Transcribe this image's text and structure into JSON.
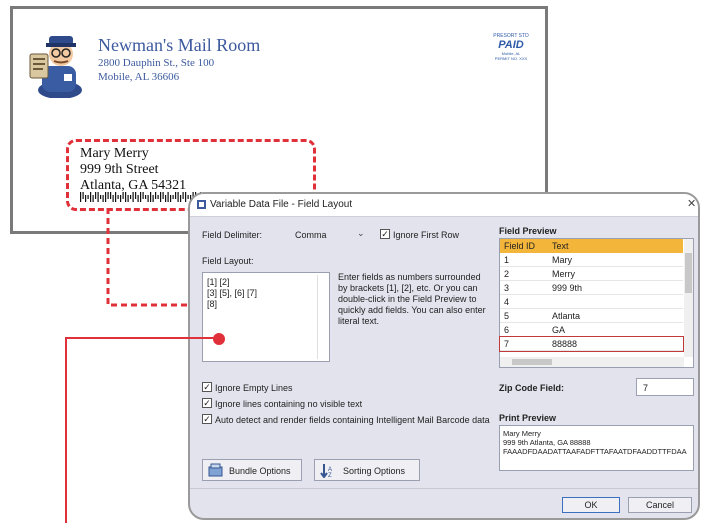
{
  "envelope": {
    "sender": {
      "name": "Newman's Mail Room",
      "line1": "2800 Dauphin St., Ste 100",
      "line2": "Mobile, AL 36606"
    },
    "postage": {
      "line1": "PRESORT STD",
      "paid": "PAID",
      "line2": "Mobile, AL",
      "line3": "PERMIT NO. XXX"
    },
    "recipient": {
      "line1": "Mary Merry",
      "line2": "999 9th Street",
      "line3": "Atlanta, GA 54321"
    }
  },
  "dialog": {
    "title": "Variable Data File - Field Layout",
    "field_delimiter_label": "Field Delimiter:",
    "field_delimiter_value": "Comma",
    "ignore_first_row_label": "Ignore First Row",
    "field_layout_label": "Field Layout:",
    "field_layout_lines": [
      "[1] [2]",
      "[3] [5], [6] [7]",
      "[8]"
    ],
    "help_text": "Enter fields as numbers surrounded by brackets [1], [2], etc.  Or you can double-click in the Field Preview to quickly add fields.  You can also enter literal text.",
    "field_preview_label": "Field Preview",
    "field_preview_headers": [
      "Field ID",
      "Text"
    ],
    "field_preview_rows": [
      [
        "1",
        "Mary"
      ],
      [
        "2",
        "Merry"
      ],
      [
        "3",
        "999 9th"
      ],
      [
        "4",
        ""
      ],
      [
        "5",
        "Atlanta"
      ],
      [
        "6",
        "GA"
      ],
      [
        "7",
        "88888"
      ]
    ],
    "ignore_empty_lines_label": "Ignore Empty Lines",
    "ignore_no_visible_label": "Ignore lines containing no visible text",
    "auto_detect_label": "Auto detect and render fields containing Intelligent Mail Barcode data",
    "zip_code_field_label": "Zip Code Field:",
    "zip_code_field_value": "7",
    "print_preview_label": "Print Preview",
    "print_preview_lines": [
      "Mary Merry",
      "999 9th Atlanta, GA 88888",
      "FAAADFDAADATTAAFADFTTAFAATDFAADDTTFDAA"
    ],
    "bundle_options_label": "Bundle Options",
    "sorting_options_label": "Sorting Options",
    "ok_label": "OK",
    "cancel_label": "Cancel"
  },
  "colors": {
    "accent_red": "#e0303a",
    "header_orange": "#f4b63a",
    "brand_blue": "#3d5a9e"
  }
}
